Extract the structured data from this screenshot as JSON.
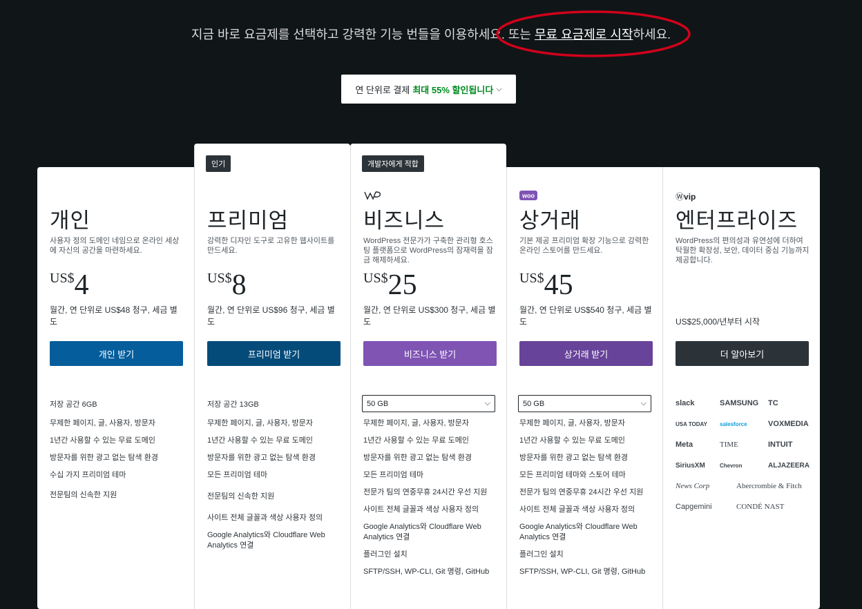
{
  "hero": {
    "text_before": "지금 바로 요금제를 선택하고 강력한 기능 번들을 이용하세요. 또는 ",
    "free_link": "무료 요금제로 시작",
    "text_after": "하세요."
  },
  "billing_toggle": {
    "label": "연 단위로 결제",
    "discount": "최대 55% 할인됩니다"
  },
  "plans": [
    {
      "name": "개인",
      "desc": "사용자 정의 도메인 네임으로 온라인 세상에 자신의 공간을 마련하세요.",
      "currency": "US$",
      "price": "4",
      "billing": "월간, 연 단위로 US$48 청구, 세금 별도",
      "cta": "개인 받기",
      "cta_color": "#055d9c",
      "storage": "저장 공간 6GB",
      "features": [
        "무제한 페이지, 글, 사용자, 방문자",
        "1년간 사용할 수 있는 무료 도메인",
        "방문자를 위한 광고 없는 탐색 환경",
        "수십 가지 프리미엄 테마",
        "전문팀의 신속한 지원"
      ]
    },
    {
      "badge": "인기",
      "name": "프리미엄",
      "desc": "강력한 디자인 도구로 고유한 웹사이트를 만드세요.",
      "currency": "US$",
      "price": "8",
      "billing": "월간, 연 단위로 US$96 청구, 세금 별도",
      "cta": "프리미엄 받기",
      "cta_color": "#044b7a",
      "storage": "저장 공간 13GB",
      "features": [
        "무제한 페이지, 글, 사용자, 방문자",
        "1년간 사용할 수 있는 무료 도메인",
        "방문자를 위한 광고 없는 탐색 환경",
        "모든 프리미엄 테마",
        "전문팀의 신속한 지원",
        "사이트 전체 글꼴과 색상 사용자 정의",
        "Google Analytics와 Cloudflare Web Analytics 연결"
      ]
    },
    {
      "badge": "개발자에게 적합",
      "logo": "wordpress-pro-icon",
      "name": "비즈니스",
      "desc": "WordPress 전문가가 구축한 관리형 호스팅 플랫폼으로 WordPress의 잠재력을 잠금 해제하세요.",
      "currency": "US$",
      "price": "25",
      "billing": "월간, 연 단위로 US$300 청구, 세금 별도",
      "cta": "비즈니스 받기",
      "cta_color": "#7f54b3",
      "storage_option": "50 GB",
      "features": [
        "무제한 페이지, 글, 사용자, 방문자",
        "1년간 사용할 수 있는 무료 도메인",
        "방문자를 위한 광고 없는 탐색 환경",
        "모든 프리미엄 테마",
        "전문가 팀의 연중무휴 24시간 우선 지원",
        "사이트 전체 글꼴과 색상 사용자 정의",
        "Google Analytics와 Cloudflare Web Analytics 연결",
        "플러그인 설치",
        "SFTP/SSH, WP-CLI, Git 명령, GitHub"
      ]
    },
    {
      "logo": "woo",
      "name": "상거래",
      "desc": "기본 제공 프리미엄 확장 기능으로 강력한 온라인 스토어를 만드세요.",
      "currency": "US$",
      "price": "45",
      "billing": "월간, 연 단위로 US$540 청구, 세금 별도",
      "cta": "상거래 받기",
      "cta_color": "#674399",
      "storage_option": "50 GB",
      "features": [
        "무제한 페이지, 글, 사용자, 방문자",
        "1년간 사용할 수 있는 무료 도메인",
        "방문자를 위한 광고 없는 탐색 환경",
        "모든 프리미엄 테마와 스토어 테마",
        "전문가 팀의 연중무휴 24시간 우선 지원",
        "사이트 전체 글꼴과 색상 사용자 정의",
        "Google Analytics와 Cloudflare Web Analytics 연결",
        "플러그인 설치",
        "SFTP/SSH, WP-CLI, Git 명령, GitHub"
      ]
    },
    {
      "logo": "vip",
      "name": "엔터프라이즈",
      "desc": "WordPress의 편의성과 유연성에 더하여 탁월한 확장성, 보안, 데이터 중심 기능까지 제공합니다.",
      "price_text": "US$25,000/년부터 시작",
      "cta": "더 알아보기",
      "cta_color": "#2c3338",
      "clients": [
        "slack",
        "SAMSUNG",
        "TC",
        "USA TODAY",
        "salesforce",
        "VOXMEDIA",
        "Meta",
        "TIME",
        "INTUIT",
        "SiriusXM",
        "Chevron",
        "ALJAZEERA",
        "News Corp",
        "Abercrombie & Fitch",
        "Capgemini",
        "CONDÉ NAST"
      ]
    }
  ],
  "colors": {
    "background": "#101517",
    "annotation": "#d0021b",
    "discount": "#008a20"
  }
}
